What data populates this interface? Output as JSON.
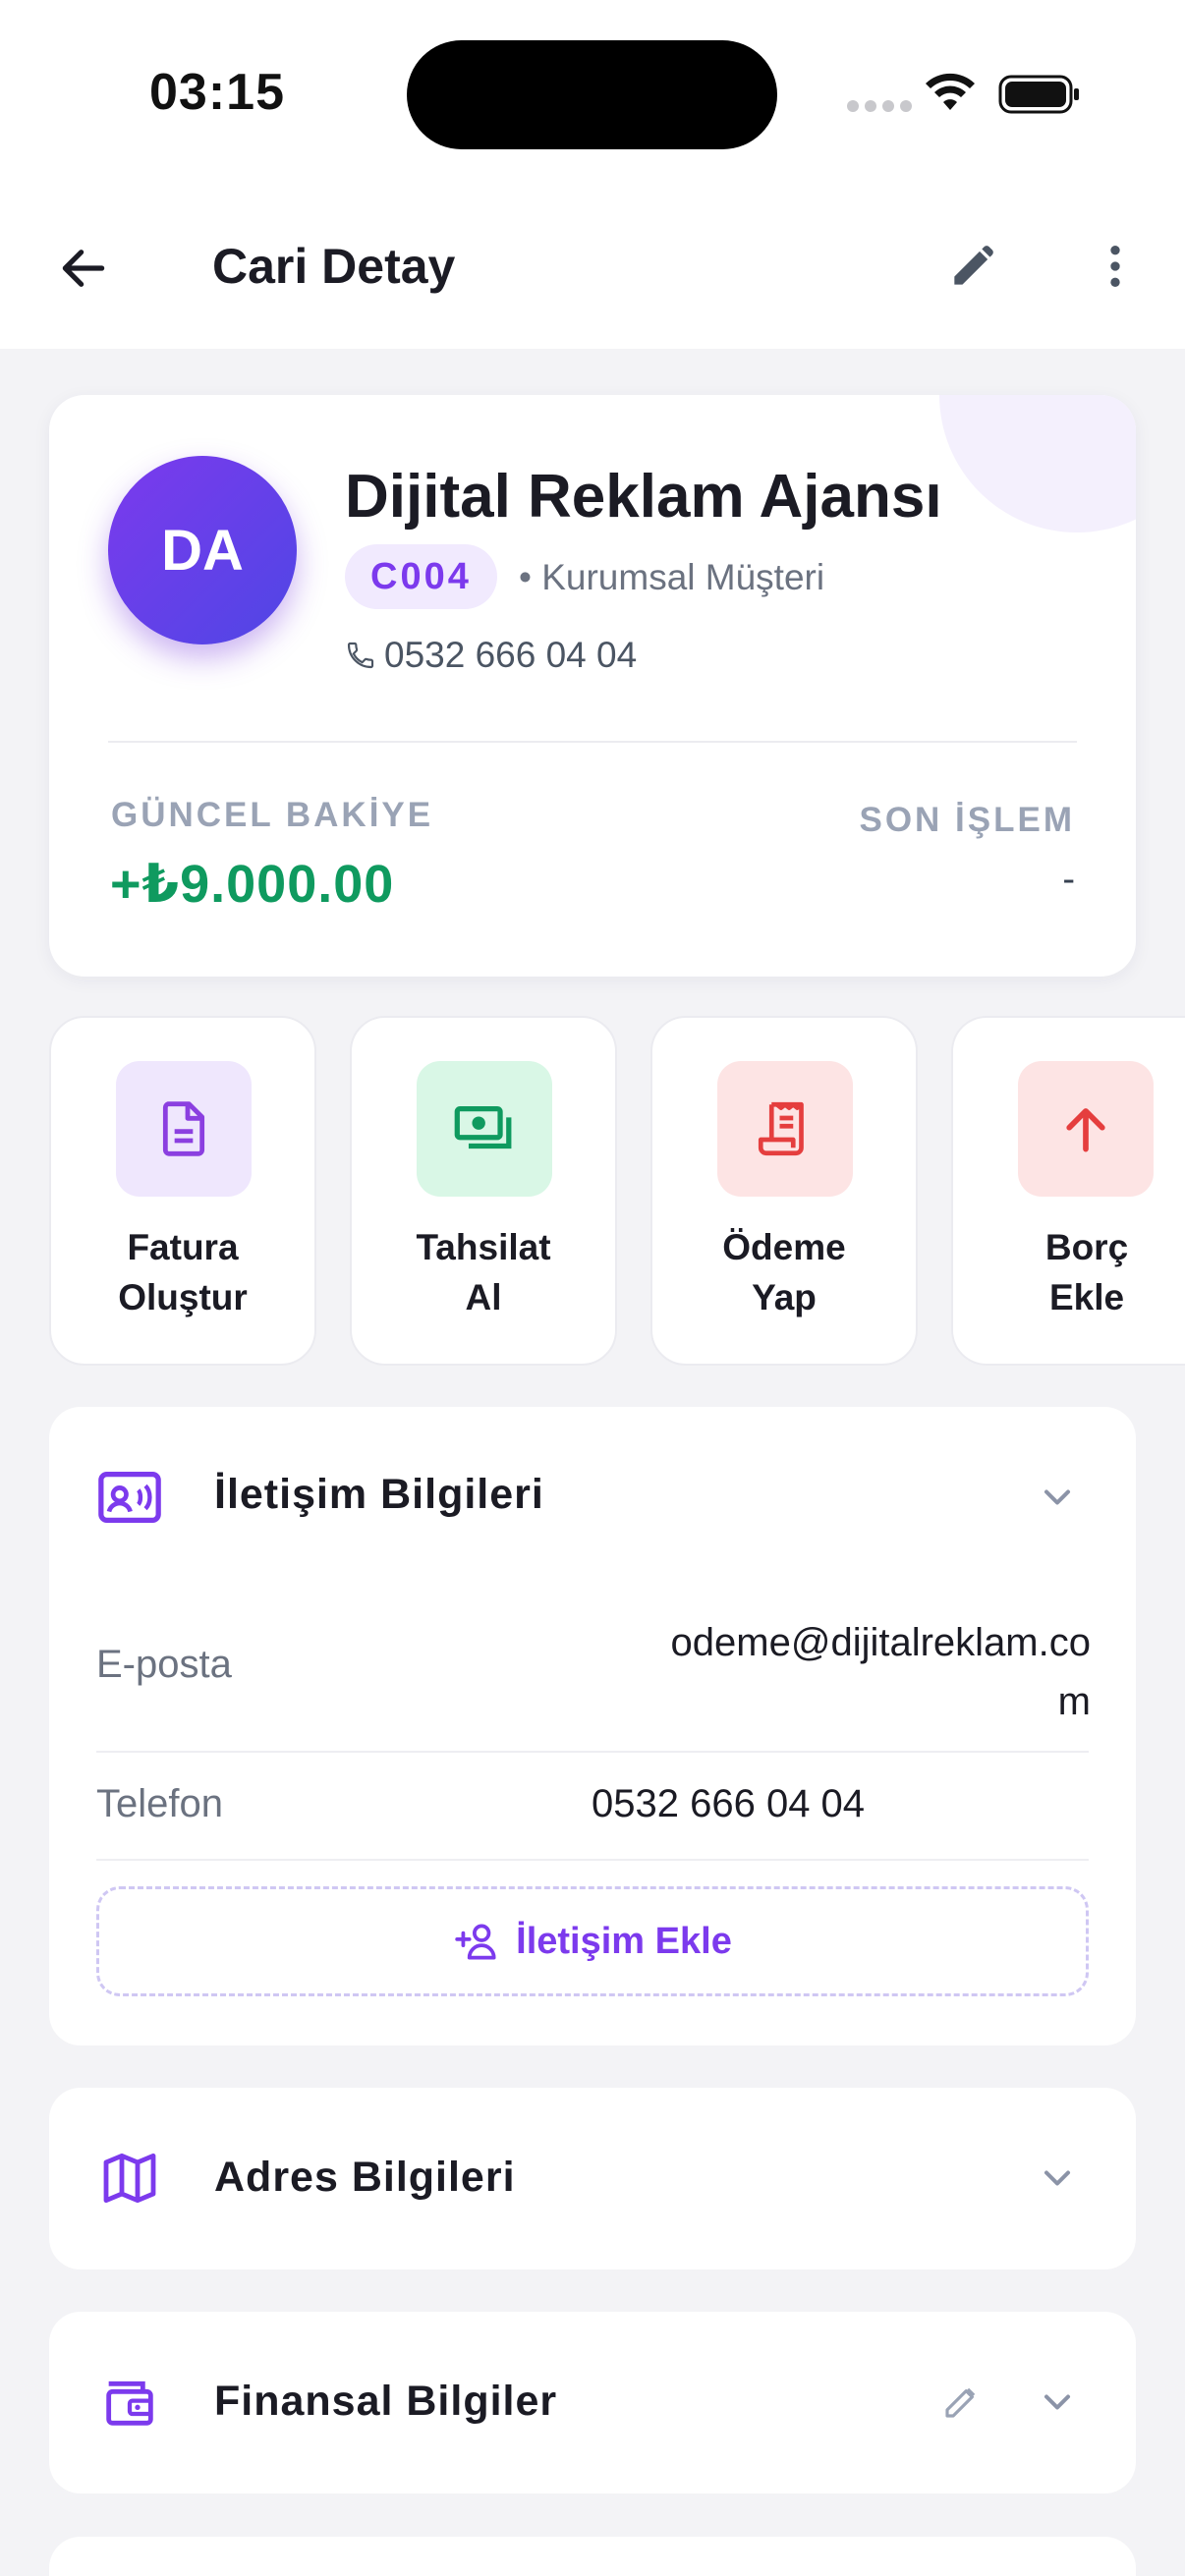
{
  "status_bar": {
    "time": "03:15"
  },
  "header": {
    "title": "Cari Detay"
  },
  "profile": {
    "initials": "DA",
    "name": "Dijital Reklam Ajansı",
    "code": "C004",
    "type": "• Kurumsal Müşteri",
    "phone": "0532 666 04 04",
    "balance_label": "GÜNCEL BAKİYE",
    "balance_value": "+₺9.000.00",
    "last_label": "SON İŞLEM",
    "last_value": "-"
  },
  "actions": [
    {
      "line1": "Fatura",
      "line2": "Oluştur",
      "icon": "document-icon",
      "bg": "#efe7fd",
      "color": "#8b3fe0"
    },
    {
      "line1": "Tahsilat",
      "line2": "Al",
      "icon": "cash-icon",
      "bg": "#d9f7e6",
      "color": "#0f9a5f"
    },
    {
      "line1": "Ödeme",
      "line2": "Yap",
      "icon": "receipt-icon",
      "bg": "#fde4e4",
      "color": "#e53e3e"
    },
    {
      "line1": "Borç",
      "line2": "Ekle",
      "icon": "arrow-up-icon",
      "bg": "#fde4e4",
      "color": "#e53e3e"
    }
  ],
  "contact_section": {
    "title": "İletişim Bilgileri",
    "email_label": "E-posta",
    "email_line1": "odeme@dijitalreklam.co",
    "email_line2": "m",
    "phone_label": "Telefon",
    "phone_value": "0532 666 04 04",
    "add_label": "İletişim Ekle"
  },
  "address_section": {
    "title": "Adres Bilgileri"
  },
  "finance_section": {
    "title": "Finansal Bilgiler"
  },
  "colors": {
    "accent": "#7c3aed",
    "positive": "#0f9a5f",
    "negative": "#e53e3e"
  }
}
